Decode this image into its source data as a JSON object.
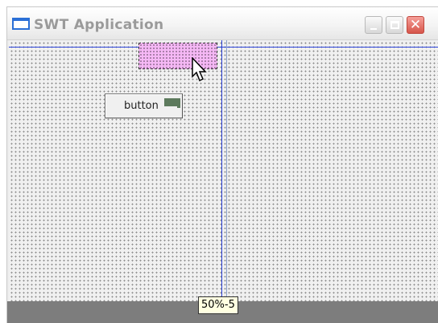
{
  "window": {
    "title": "SWT Application",
    "controls": {
      "minimize": "minimize",
      "maximize": "maximize",
      "close": "✕"
    }
  },
  "canvas": {
    "widget_button_label": "button",
    "selection_color": "#f5b8f5",
    "guide_color": "#2c43d8"
  },
  "tooltip": {
    "text": "50%-5"
  }
}
